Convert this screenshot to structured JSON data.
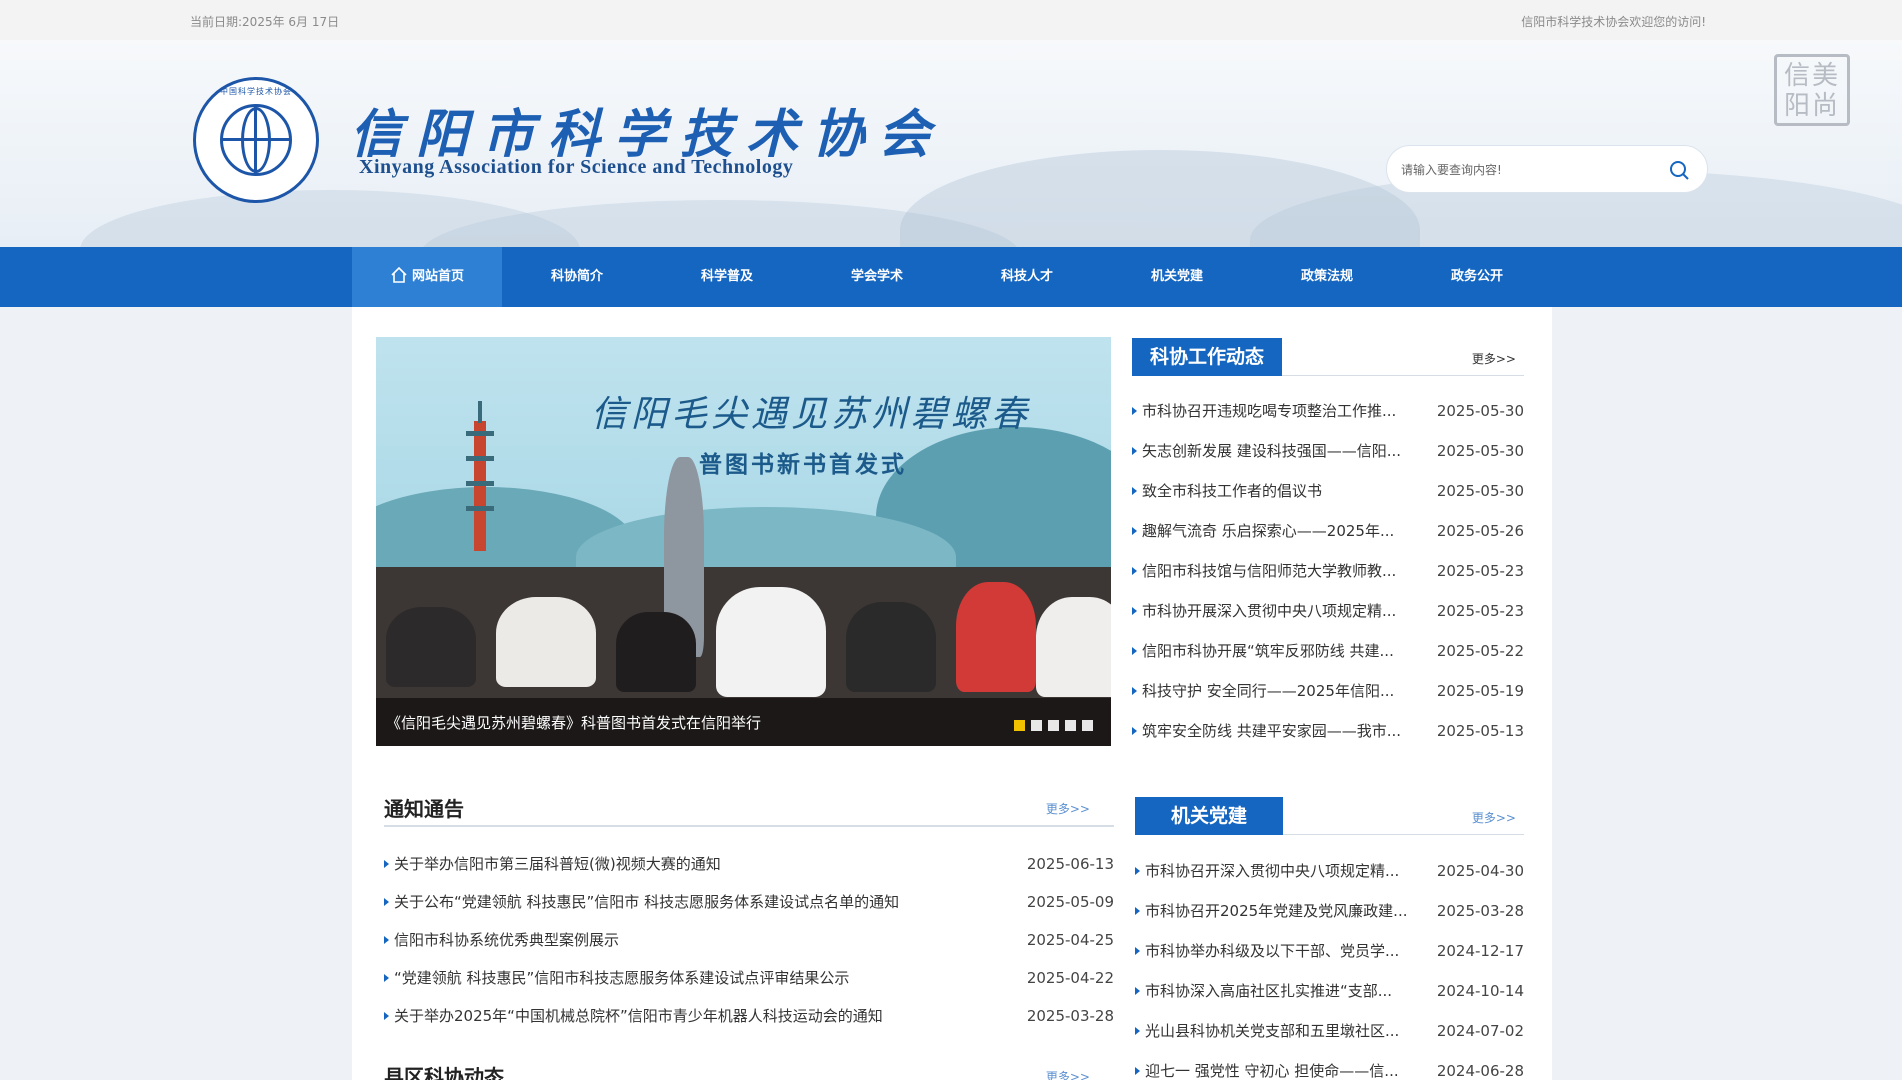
{
  "topbar": {
    "date": "当前日期:2025年 6月 17日",
    "welcome": "信阳市科学技术协会欢迎您的访问!"
  },
  "header": {
    "logo_cn": "信阳市科学技术协会",
    "logo_en": "Xinyang Association for Science and Technology",
    "emblem_text": "中国科学技术协会",
    "seal_text": "信美阳尚"
  },
  "search": {
    "placeholder": "请输入要查询内容!",
    "icon": "search-icon"
  },
  "nav": {
    "items": [
      {
        "label": "网站首页",
        "icon": "home-icon"
      },
      {
        "label": "科协简介"
      },
      {
        "label": "科学普及"
      },
      {
        "label": "学会学术"
      },
      {
        "label": "科技人才"
      },
      {
        "label": "机关党建"
      },
      {
        "label": "政策法规"
      },
      {
        "label": "政务公开"
      }
    ]
  },
  "slider": {
    "banner_title": "信阳毛尖遇见苏州碧螺春",
    "banner_sub": "普图书新书首发式",
    "caption": "《信阳毛尖遇见苏州碧螺春》科普图书首发式在信阳举行",
    "dot_count": 5,
    "active_dot": 0
  },
  "work_news": {
    "title": "科协工作动态",
    "more": "更多>>",
    "items": [
      {
        "title": "市科协召开违规吃喝专项整治工作推...",
        "date": "2025-05-30"
      },
      {
        "title": "矢志创新发展 建设科技强国——信阳...",
        "date": "2025-05-30"
      },
      {
        "title": "致全市科技工作者的倡议书",
        "date": "2025-05-30"
      },
      {
        "title": "趣解气流奇 乐启探索心——2025年...",
        "date": "2025-05-26"
      },
      {
        "title": "信阳市科技馆与信阳师范大学教师教...",
        "date": "2025-05-23"
      },
      {
        "title": "市科协开展深入贯彻中央八项规定精...",
        "date": "2025-05-23"
      },
      {
        "title": "信阳市科协开展“筑牢反邪防线 共建...",
        "date": "2025-05-22"
      },
      {
        "title": "科技守护 安全同行——2025年信阳...",
        "date": "2025-05-19"
      },
      {
        "title": "筑牢安全防线 共建平安家园——我市...",
        "date": "2025-05-13"
      }
    ]
  },
  "notices": {
    "title": "通知通告",
    "more": "更多>>",
    "items": [
      {
        "title": "关于举办信阳市第三届科普短(微)视频大赛的通知",
        "date": "2025-06-13"
      },
      {
        "title": "关于公布“党建领航 科技惠民”信阳市 科技志愿服务体系建设试点名单的通知",
        "date": "2025-05-09"
      },
      {
        "title": "信阳市科协系统优秀典型案例展示",
        "date": "2025-04-25"
      },
      {
        "title": "“党建领航 科技惠民”信阳市科技志愿服务体系建设试点评审结果公示",
        "date": "2025-04-22"
      },
      {
        "title": "关于举办2025年“中国机械总院杯”信阳市青少年机器人科技运动会的通知",
        "date": "2025-03-28"
      }
    ]
  },
  "party": {
    "title": "机关党建",
    "more": "更多>>",
    "items": [
      {
        "title": "市科协召开深入贯彻中央八项规定精...",
        "date": "2025-04-30"
      },
      {
        "title": "市科协召开2025年党建及党风廉政建...",
        "date": "2025-03-28"
      },
      {
        "title": "市科协举办科级及以下干部、党员学...",
        "date": "2024-12-17"
      },
      {
        "title": "市科协深入高庙社区扎实推进“支部...",
        "date": "2024-10-14"
      },
      {
        "title": "光山县科协机关党支部和五里墩社区...",
        "date": "2024-07-02"
      },
      {
        "title": "迎七一 强党性 守初心 担使命——信...",
        "date": "2024-06-28"
      }
    ]
  },
  "county": {
    "title": "县区科协动态",
    "more": "更多>>"
  },
  "colors": {
    "brand_blue": "#1466c1",
    "active_nav": "#2e80d4",
    "active_dot": "#f2c200"
  }
}
